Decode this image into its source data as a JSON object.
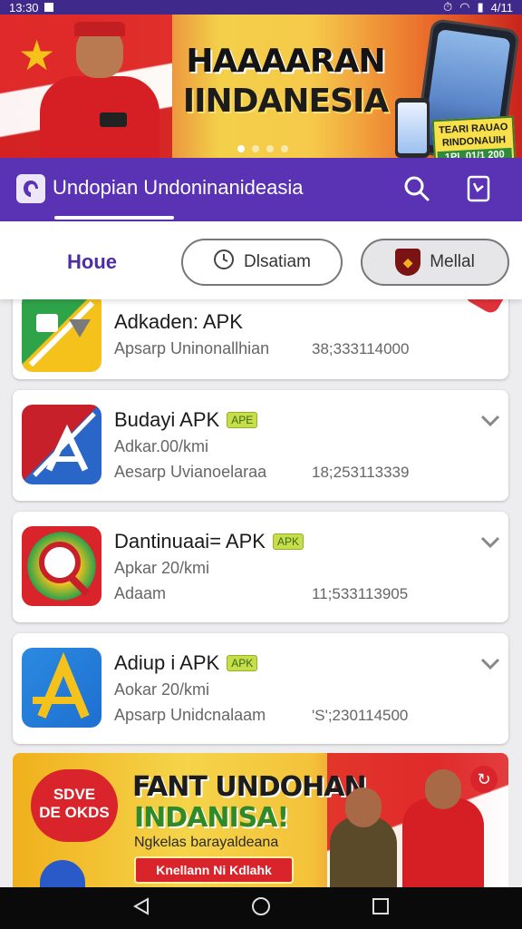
{
  "status_bar": {
    "time": "13:30",
    "battery": "4/11"
  },
  "hero": {
    "title_line1": "HAAAARAN",
    "title_line2": "IINDANESIA",
    "badge_line1": "TEARI RAUAO",
    "badge_line2": "RINDONAUIH",
    "badge_line3": "1PL 01/1 200",
    "page_indicator": {
      "count": 4,
      "active": 0
    }
  },
  "app_bar": {
    "title": "Undopian Undoninanideasia"
  },
  "tabs": {
    "home": "Houe",
    "tab2": "Dlsatiam",
    "tab3": "Mellal"
  },
  "apps": [
    {
      "name": "Adkaden: APK",
      "sub": "",
      "meta": "Apsarp Uninonallhian",
      "size": "38;333114000"
    },
    {
      "name": "Budayi APK",
      "badge": "APE",
      "sub": "Adkar.00/kmi",
      "meta": "Aesarp Uvianoelaraa",
      "size": "18;253113339"
    },
    {
      "name": "Dantinuaai= APK",
      "badge": "APK",
      "sub": "Apkar 20/kmi",
      "meta": "Adaam",
      "size": "11;533113905"
    },
    {
      "name": "Adiup i APK",
      "badge": "APK",
      "sub": "Aokar 20/kmi",
      "meta": "Apsarp Unidcnalaam",
      "size": "'S';230114500"
    }
  ],
  "promo": {
    "save_line1": "SDVE",
    "save_line2": "DE OKDS",
    "headline1": "FANT UNDOHAN",
    "headline2": "INDANISA!",
    "tagline": "Ngkelas barayaldeana",
    "cta": "Knellann Ni Kdlahk"
  },
  "colors": {
    "primary": "#5a32b4",
    "accent_red": "#d8242a",
    "apk_badge": "#c8dd4a"
  },
  "icons": [
    "search-icon",
    "bookmark-icon",
    "clock-icon",
    "shield-icon",
    "chevron-down-icon",
    "back-icon",
    "home-icon",
    "recents-icon"
  ]
}
